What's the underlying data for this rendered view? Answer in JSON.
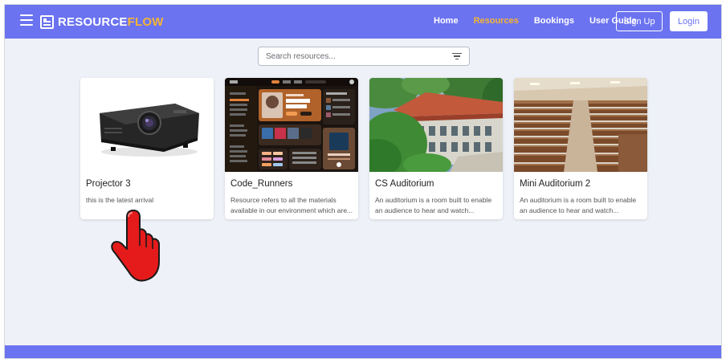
{
  "brand": {
    "name_main": "RESOURCE",
    "name_accent": "FLOW",
    "accent_color": "#f5b534",
    "primary_color": "#6b73f0"
  },
  "nav": {
    "links": [
      {
        "label": "Home",
        "active": false
      },
      {
        "label": "Resources",
        "active": true
      },
      {
        "label": "Bookings",
        "active": false
      },
      {
        "label": "User Guide",
        "active": false
      }
    ],
    "signup_label": "Sign Up",
    "login_label": "Login"
  },
  "search": {
    "placeholder": "Search resources...",
    "value": ""
  },
  "cards": [
    {
      "title": "Projector 3",
      "description": "this is the latest arrival",
      "image": "projector-image"
    },
    {
      "title": "Code_Runners",
      "description": "Resource refers to all the materials available in our environment which are...",
      "image": "music-app-screenshot-image"
    },
    {
      "title": "CS Auditorium",
      "description": "An auditorium is a room built to enable an audience to hear and watch...",
      "image": "building-exterior-image"
    },
    {
      "title": "Mini Auditorium 2",
      "description": "An auditorium is a room built to enable an audience to hear and watch...",
      "image": "lecture-hall-image"
    }
  ],
  "overlay": {
    "cursor": "pointing-hand-cursor-icon"
  }
}
